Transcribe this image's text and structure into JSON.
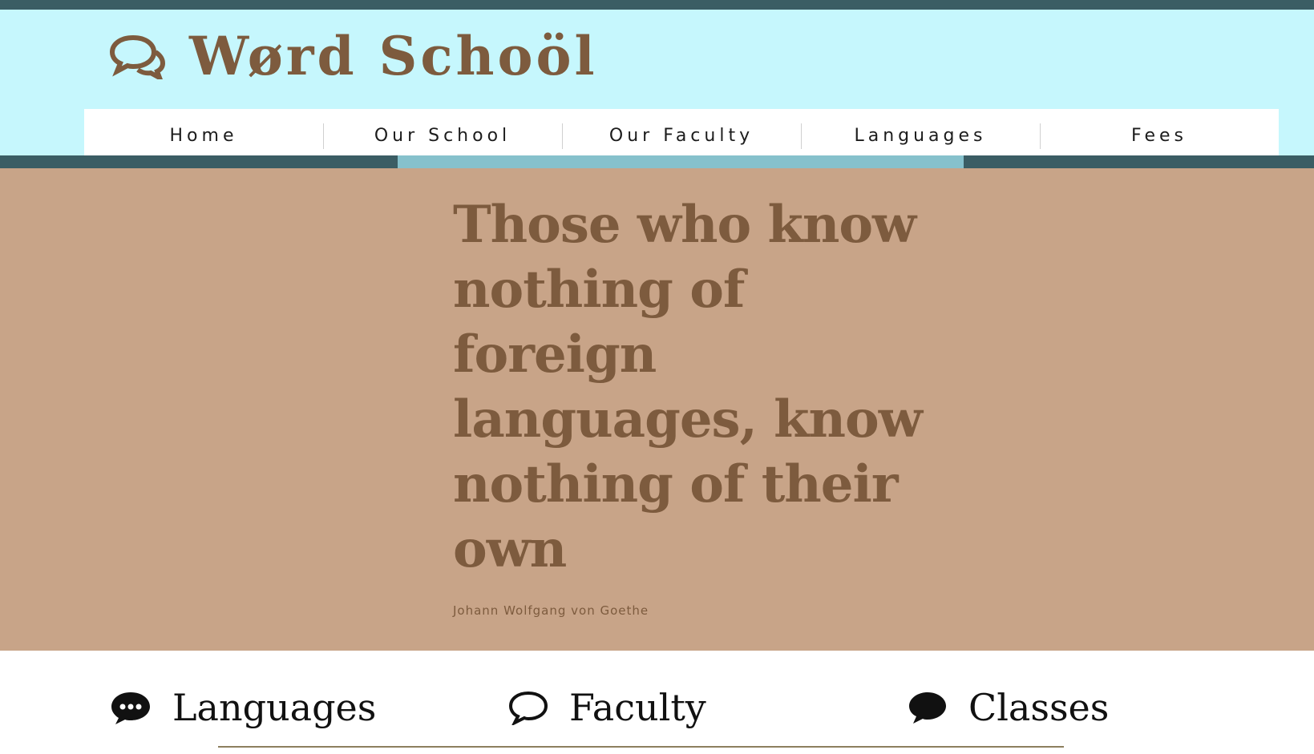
{
  "site": {
    "title": "Wørd Schoöl",
    "logo_icon": "speech-bubbles-icon"
  },
  "nav": {
    "items": [
      {
        "label": "Home"
      },
      {
        "label": "Our School"
      },
      {
        "label": "Our Faculty"
      },
      {
        "label": "Languages"
      },
      {
        "label": "Fees"
      }
    ]
  },
  "hero": {
    "quote": "Those who know nothing of foreign languages, know nothing of their own",
    "author": "Johann Wolfgang von Goethe"
  },
  "features": [
    {
      "label": "Languages",
      "icon": "chat-dots-icon"
    },
    {
      "label": "Faculty",
      "icon": "speech-bubble-outline-icon"
    },
    {
      "label": "Classes",
      "icon": "speech-bubble-solid-icon"
    }
  ],
  "colors": {
    "brand_brown": "#7d5b3e",
    "header_bg": "#c6f7fd",
    "hero_bg": "#c8a488",
    "accent_dark": "#3b5d64",
    "accent_light": "#86c1cc"
  }
}
